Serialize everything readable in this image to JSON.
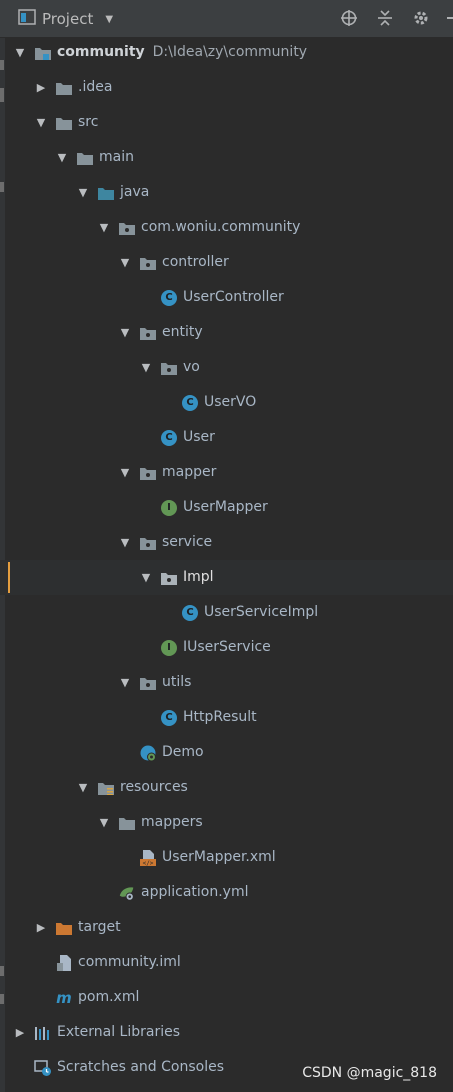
{
  "header": {
    "title": "Project"
  },
  "tree": {
    "root": {
      "label": "community",
      "path": "D:\\Idea\\zy\\community"
    },
    "idea": ".idea",
    "src": "src",
    "main": "main",
    "java": "java",
    "package": "com.woniu.community",
    "controller": "controller",
    "user_controller": "UserController",
    "entity": "entity",
    "vo": "vo",
    "user_vo": "UserVO",
    "user": "User",
    "mapper": "mapper",
    "user_mapper": "UserMapper",
    "service": "service",
    "impl": "Impl",
    "user_service_impl": "UserServiceImpl",
    "iuser_service": "IUserService",
    "utils": "utils",
    "http_result": "HttpResult",
    "demo": "Demo",
    "resources": "resources",
    "mappers": "mappers",
    "user_mapper_xml": "UserMapper.xml",
    "application_yml": "application.yml",
    "target": "target",
    "community_iml": "community.iml",
    "pom": "pom.xml",
    "external_libraries": "External Libraries",
    "scratches": "Scratches and Consoles"
  },
  "watermark": "CSDN @magic_818",
  "colors": {
    "background": "#2b2b2b",
    "folder": "#87939a",
    "source_folder": "#3e86a0",
    "class_icon": "#3592c4",
    "interface_icon": "#629755",
    "selection_marker": "#e49e3f"
  }
}
